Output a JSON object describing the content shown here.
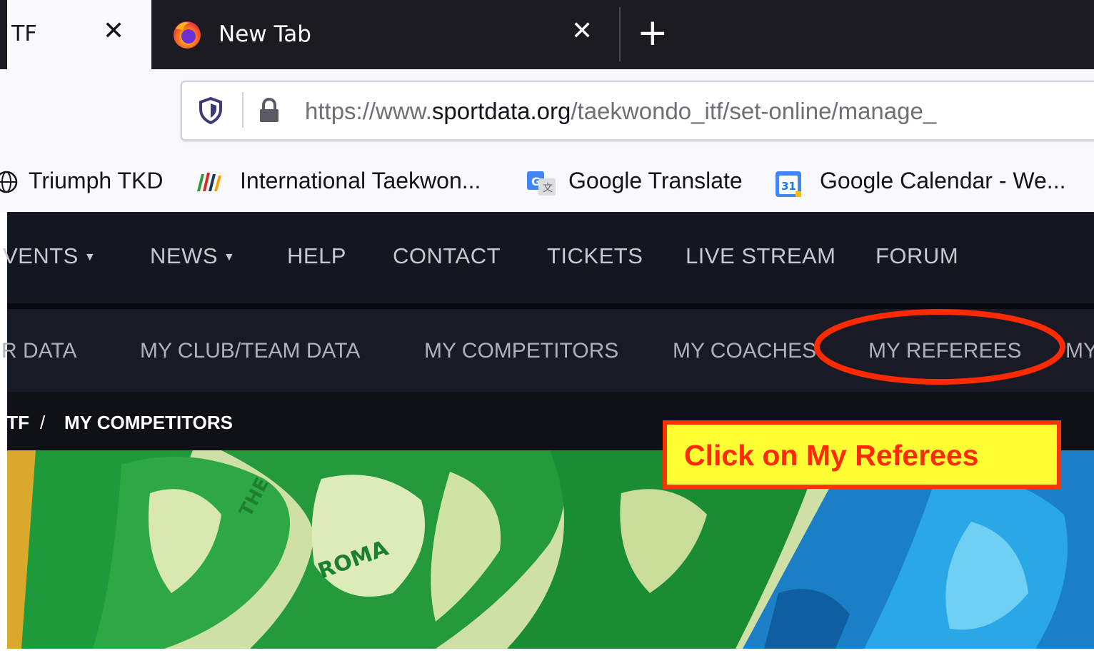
{
  "browser": {
    "tabs": [
      {
        "title": "TF",
        "active": true
      },
      {
        "title": "New Tab",
        "active": false
      }
    ],
    "new_tab_symbol": "+",
    "close_symbol": "✕",
    "url": {
      "prefix": "https://www.",
      "domain": "sportdata.org",
      "path": "/taekwondo_itf/set-online/manage_"
    },
    "bookmarks": [
      {
        "label": "Triumph TKD",
        "icon": "globe-icon"
      },
      {
        "label": "International Taekwon...",
        "icon": "itf-flag-icon"
      },
      {
        "label": "Google Translate",
        "icon": "google-translate-icon"
      },
      {
        "label": "Google Calendar - We...",
        "icon": "google-calendar-icon",
        "icon_text": "31"
      }
    ]
  },
  "site": {
    "main_nav": [
      {
        "label": "VENTS",
        "dropdown": true
      },
      {
        "label": "NEWS",
        "dropdown": true
      },
      {
        "label": "HELP"
      },
      {
        "label": "CONTACT"
      },
      {
        "label": "TICKETS"
      },
      {
        "label": "LIVE STREAM"
      },
      {
        "label": "FORUM"
      }
    ],
    "caret": "▼",
    "sub_nav": [
      {
        "label": "R DATA"
      },
      {
        "label": "MY CLUB/TEAM DATA"
      },
      {
        "label": "MY COMPETITORS"
      },
      {
        "label": "MY COACHES"
      },
      {
        "label": "MY REFEREES"
      },
      {
        "label": "MY"
      }
    ],
    "breadcrumb": {
      "parent": "ITF",
      "separator": "/",
      "current": "MY COMPETITORS"
    }
  },
  "annotation": {
    "callout": "Click on My Referees",
    "highlight_target": "MY REFEREES",
    "colors": {
      "fill": "#ffff33",
      "border": "#ff3300",
      "text": "#ff2a00"
    }
  }
}
